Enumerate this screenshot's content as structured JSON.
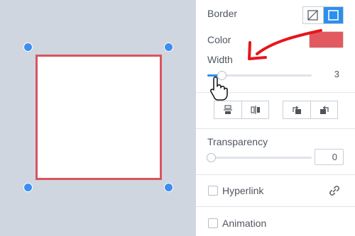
{
  "panel": {
    "border_label": "Border",
    "color_label": "Color",
    "border_color": "#e25a60",
    "width_label": "Width",
    "width_value": "3",
    "transparency_label": "Transparency",
    "transparency_value": "0",
    "hyperlink_label": "Hyperlink",
    "animation_label": "Animation",
    "border_toggle": [
      "no-border-icon",
      "solid-border-icon"
    ],
    "arrange_buttons": [
      "align-bottom-icon",
      "align-center-icon",
      "rotate-left-icon",
      "rotate-right-icon"
    ],
    "link_icon": "link-icon"
  },
  "colors": {
    "accent": "#2b8ff0",
    "shape_border": "#d9545c",
    "annotation_arrow": "#e8141a"
  }
}
